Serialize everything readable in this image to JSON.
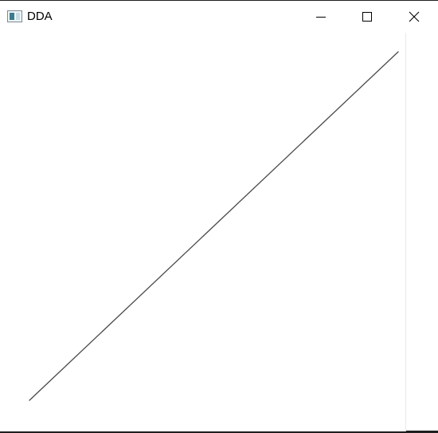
{
  "window": {
    "title": "DDA",
    "app_icon": "window-app-icon",
    "controls": {
      "minimize": "minimize-icon",
      "maximize": "maximize-icon",
      "close": "close-icon"
    }
  },
  "drawing": {
    "line_color": "#4a4a4a"
  }
}
